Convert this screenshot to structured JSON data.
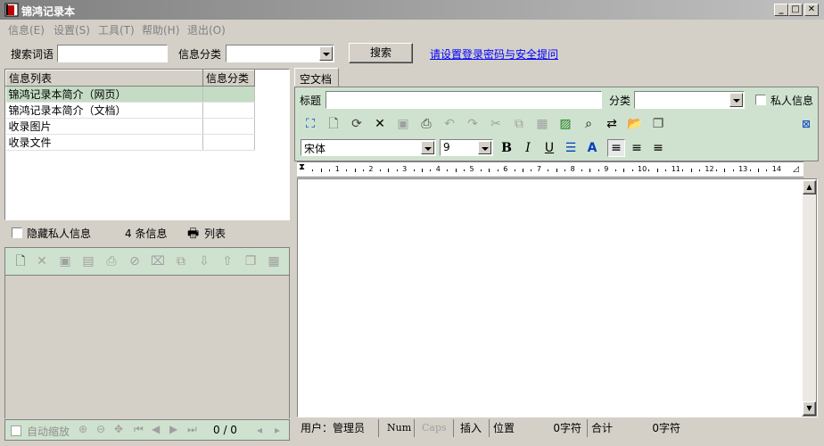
{
  "window": {
    "title": "锦鸿记录本"
  },
  "menu": [
    "信息(E)",
    "设置(S)",
    "工具(T)",
    "帮助(H)",
    "退出(O)"
  ],
  "search": {
    "term_label": "搜索词语",
    "term_value": "",
    "category_label": "信息分类",
    "category_value": "",
    "button_label": "搜索",
    "link_text": "请设置登录密码与安全提问"
  },
  "info_list": {
    "columns": [
      "信息列表",
      "信息分类"
    ],
    "rows": [
      {
        "name": "锦鸿记录本简介（网页）",
        "category": ""
      },
      {
        "name": "锦鸿记录本简介（文档）",
        "category": ""
      },
      {
        "name": "收录图片",
        "category": ""
      },
      {
        "name": "收录文件",
        "category": ""
      }
    ],
    "selected_index": 0
  },
  "list_footer": {
    "hide_private_label": "隐藏私人信息",
    "count_text": "4 条信息",
    "list_button_label": "列表"
  },
  "preview": {
    "auto_zoom_label": "自动缩放",
    "page_text": "0 / 0"
  },
  "editor": {
    "tab_label": "空文档",
    "title_label": "标题",
    "title_value": "",
    "category_label": "分类",
    "category_value": "",
    "private_label": "私人信息",
    "font_name": "宋体",
    "font_size": "9",
    "ruler_ticks": [
      "1",
      "2",
      "3",
      "4",
      "5",
      "6",
      "7",
      "8",
      "9",
      "10",
      "11",
      "12",
      "13",
      "14"
    ]
  },
  "status": {
    "user_text": "用户：管理员",
    "num": "Num",
    "caps": "Caps",
    "insert": "插入",
    "position_label": "位置",
    "position_value": "0字符",
    "total_label": "合计",
    "total_value": "0字符"
  }
}
